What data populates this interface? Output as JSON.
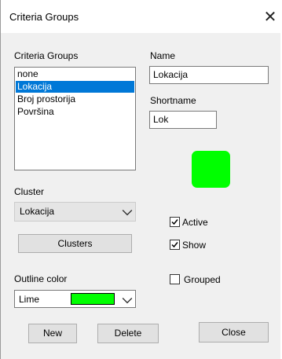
{
  "window": {
    "title": "Criteria Groups",
    "close_icon": "close-icon"
  },
  "groups": {
    "label": "Criteria Groups",
    "items": [
      "none",
      "Lokacija",
      "Broj prostorija",
      "Površina"
    ],
    "selected_index": 1
  },
  "name": {
    "label": "Name",
    "value": "Lokacija"
  },
  "shortname": {
    "label": "Shortname",
    "value": "Lok"
  },
  "group_color": "#00ff00",
  "cluster": {
    "label": "Cluster",
    "value": "Lokacija",
    "button": "Clusters"
  },
  "outline": {
    "label": "Outline color",
    "value": "Lime",
    "color": "#00ff00"
  },
  "checks": {
    "active": {
      "label": "Active",
      "checked": true
    },
    "show": {
      "label": "Show",
      "checked": true
    },
    "grouped": {
      "label": "Grouped",
      "checked": false
    }
  },
  "buttons": {
    "new": "New",
    "delete": "Delete",
    "close": "Close"
  }
}
